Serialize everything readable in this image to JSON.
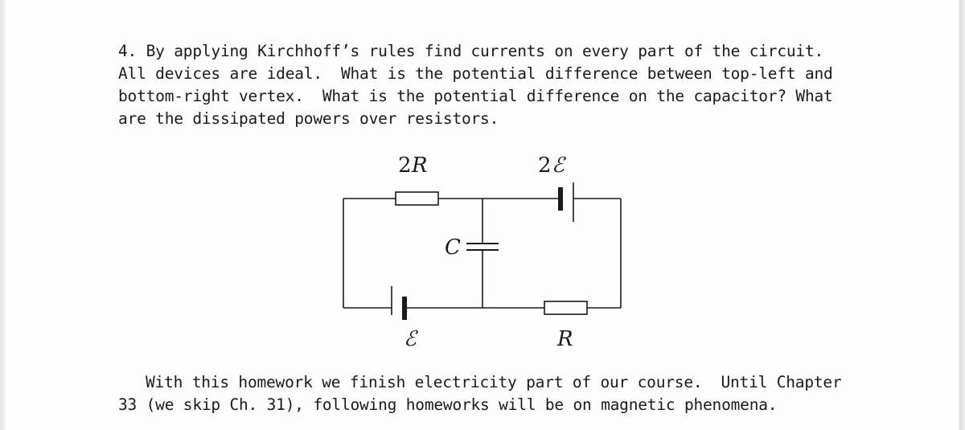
{
  "problem": {
    "lines": [
      "4. By applying Kirchhoff’s rules find currents on every part of the circuit.",
      "All devices are ideal.  What is the potential difference between top-left and",
      "bottom-right vertex.  What is the potential difference on the capacitor? What",
      "are the dissipated powers over resistors."
    ]
  },
  "circuit": {
    "labels": {
      "top_resistor_coef": "2",
      "top_resistor_sym": "R",
      "top_battery_coef": "2",
      "top_battery_sym": "ℰ",
      "capacitor": "C",
      "bottom_battery": "ℰ",
      "bottom_resistor": "R"
    },
    "components": [
      {
        "type": "resistor",
        "value": "2R",
        "branch": "top-left"
      },
      {
        "type": "battery",
        "value": "2ℰ",
        "branch": "top-right"
      },
      {
        "type": "capacitor",
        "value": "C",
        "branch": "middle"
      },
      {
        "type": "battery",
        "value": "ℰ",
        "branch": "bottom-left"
      },
      {
        "type": "resistor",
        "value": "R",
        "branch": "bottom-right"
      }
    ]
  },
  "footer": {
    "lines": [
      "With this homework we finish electricity part of our course.  Until Chapter",
      "33 (we skip Ch. 31), following homeworks will be on magnetic phenomena."
    ]
  }
}
